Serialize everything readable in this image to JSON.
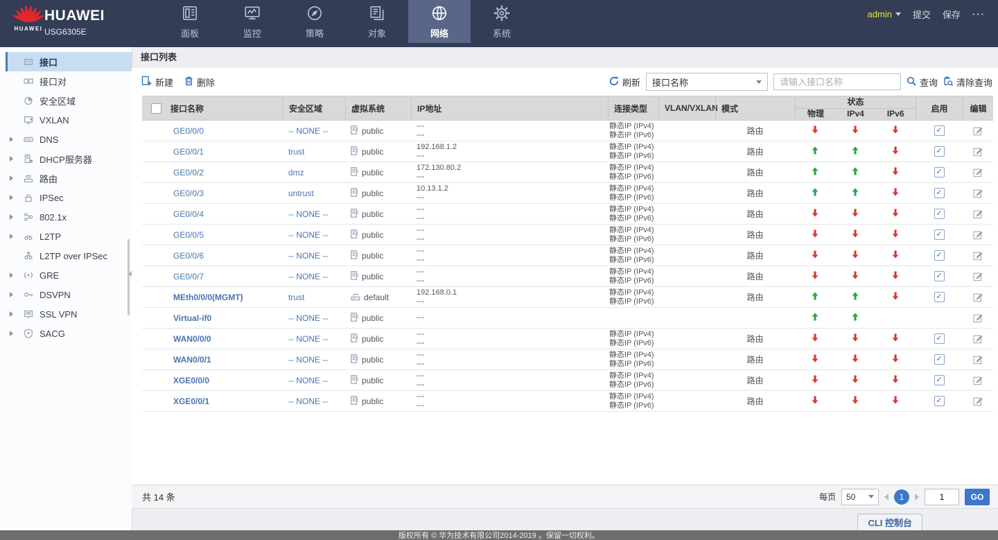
{
  "colors": {
    "nav_bg": "#333d55",
    "nav_active_bg": "#5a6687",
    "accent_blue": "#3a74c0",
    "link_blue": "#4a74ad",
    "status_up": "#2ca44a",
    "status_down": "#d43c35",
    "admin_yellow": "#e9e72e",
    "header_gray": "#d9d9d9"
  },
  "brand": {
    "name": "HUAWEI",
    "model": "USG6305E",
    "logo_caption": "HUAWEI",
    "logo_icon": "huawei-logo"
  },
  "topnav": {
    "items": [
      {
        "id": "dashboard",
        "label": "面板",
        "icon": "dashboard-icon",
        "active": false
      },
      {
        "id": "monitor",
        "label": "监控",
        "icon": "monitor-icon",
        "active": false
      },
      {
        "id": "policy",
        "label": "策略",
        "icon": "policy-icon",
        "active": false
      },
      {
        "id": "object",
        "label": "对象",
        "icon": "object-icon",
        "active": false
      },
      {
        "id": "network",
        "label": "网络",
        "icon": "network-icon",
        "active": true
      },
      {
        "id": "system",
        "label": "系统",
        "icon": "system-icon",
        "active": false
      }
    ],
    "user": "admin",
    "submit_label": "提交",
    "save_label": "保存",
    "more_label": "···"
  },
  "sidebar": {
    "items": [
      {
        "id": "interface",
        "label": "接口",
        "icon": "interface-icon",
        "expandable": false,
        "selected": true
      },
      {
        "id": "interface-pair",
        "label": "接口对",
        "icon": "interface-pair-icon",
        "expandable": false,
        "selected": false
      },
      {
        "id": "security-zone",
        "label": "安全区域",
        "icon": "security-zone-icon",
        "expandable": false,
        "selected": false
      },
      {
        "id": "vxlan",
        "label": "VXLAN",
        "icon": "vxlan-icon",
        "expandable": false,
        "selected": false
      },
      {
        "id": "dns",
        "label": "DNS",
        "icon": "dns-icon",
        "expandable": true,
        "selected": false
      },
      {
        "id": "dhcp",
        "label": "DHCP服务器",
        "icon": "dhcp-icon",
        "expandable": true,
        "selected": false
      },
      {
        "id": "route",
        "label": "路由",
        "icon": "route-icon",
        "expandable": true,
        "selected": false
      },
      {
        "id": "ipsec",
        "label": "IPSec",
        "icon": "ipsec-icon",
        "expandable": true,
        "selected": false
      },
      {
        "id": "8021x",
        "label": "802.1x",
        "icon": "8021x-icon",
        "expandable": true,
        "selected": false
      },
      {
        "id": "l2tp",
        "label": "L2TP",
        "icon": "l2tp-icon",
        "expandable": true,
        "selected": false
      },
      {
        "id": "l2tp-over-ipsec",
        "label": "L2TP over IPSec",
        "icon": "l2tp-ipsec-icon",
        "expandable": false,
        "selected": false
      },
      {
        "id": "gre",
        "label": "GRE",
        "icon": "gre-icon",
        "expandable": true,
        "selected": false
      },
      {
        "id": "dsvpn",
        "label": "DSVPN",
        "icon": "dsvpn-icon",
        "expandable": true,
        "selected": false
      },
      {
        "id": "ssl-vpn",
        "label": "SSL VPN",
        "icon": "ssl-vpn-icon",
        "expandable": true,
        "selected": false
      },
      {
        "id": "sacg",
        "label": "SACG",
        "icon": "sacg-icon",
        "expandable": true,
        "selected": false
      }
    ]
  },
  "panel": {
    "title": "接口列表"
  },
  "toolbar": {
    "new_label": "新建",
    "delete_label": "删除",
    "refresh_label": "刷新",
    "filter_selected": "接口名称",
    "search_placeholder": "请输入接口名称",
    "query_label": "查询",
    "clear_label": "清除查询"
  },
  "table": {
    "headers": {
      "name": "接口名称",
      "zone": "安全区域",
      "vsys": "虚拟系统",
      "ip": "IP地址",
      "conn": "连接类型",
      "vlan": "VLAN/VXLAN",
      "mode": "模式",
      "status": "状态",
      "phys": "物理",
      "ipv4": "IPv4",
      "ipv6": "IPv6",
      "enable": "启用",
      "edit": "编辑"
    },
    "rows": [
      {
        "name": "GE0/0/0",
        "bold": false,
        "zone": "-- NONE --",
        "vsys": "public",
        "vsys_icon": "vsys-public-icon",
        "ip": [
          "---",
          "---"
        ],
        "conn": [
          "静态IP (IPv4)",
          "静态IP (IPv6)"
        ],
        "mode": "路由",
        "phys": "down",
        "ipv4": "down",
        "ipv6": "down",
        "enabled": true
      },
      {
        "name": "GE0/0/1",
        "bold": false,
        "zone": "trust",
        "vsys": "public",
        "vsys_icon": "vsys-public-icon",
        "ip": [
          "192.168.1.2",
          "---"
        ],
        "conn": [
          "静态IP (IPv4)",
          "静态IP (IPv6)"
        ],
        "mode": "路由",
        "phys": "up",
        "ipv4": "up",
        "ipv6": "down",
        "enabled": true
      },
      {
        "name": "GE0/0/2",
        "bold": false,
        "zone": "dmz",
        "vsys": "public",
        "vsys_icon": "vsys-public-icon",
        "ip": [
          "172.130.80.2",
          "---"
        ],
        "conn": [
          "静态IP (IPv4)",
          "静态IP (IPv6)"
        ],
        "mode": "路由",
        "phys": "up",
        "ipv4": "up",
        "ipv6": "down",
        "enabled": true
      },
      {
        "name": "GE0/0/3",
        "bold": false,
        "zone": "untrust",
        "vsys": "public",
        "vsys_icon": "vsys-public-icon",
        "ip": [
          "10.13.1.2",
          "---"
        ],
        "conn": [
          "静态IP (IPv4)",
          "静态IP (IPv6)"
        ],
        "mode": "路由",
        "phys": "up",
        "ipv4": "up",
        "ipv6": "down",
        "enabled": true
      },
      {
        "name": "GE0/0/4",
        "bold": false,
        "zone": "-- NONE --",
        "vsys": "public",
        "vsys_icon": "vsys-public-icon",
        "ip": [
          "---",
          "---"
        ],
        "conn": [
          "静态IP (IPv4)",
          "静态IP (IPv6)"
        ],
        "mode": "路由",
        "phys": "down",
        "ipv4": "down",
        "ipv6": "down",
        "enabled": true
      },
      {
        "name": "GE0/0/5",
        "bold": false,
        "zone": "-- NONE --",
        "vsys": "public",
        "vsys_icon": "vsys-public-icon",
        "ip": [
          "---",
          "---"
        ],
        "conn": [
          "静态IP (IPv4)",
          "静态IP (IPv6)"
        ],
        "mode": "路由",
        "phys": "down",
        "ipv4": "down",
        "ipv6": "down",
        "enabled": true
      },
      {
        "name": "GE0/0/6",
        "bold": false,
        "zone": "-- NONE --",
        "vsys": "public",
        "vsys_icon": "vsys-public-icon",
        "ip": [
          "---",
          "---"
        ],
        "conn": [
          "静态IP (IPv4)",
          "静态IP (IPv6)"
        ],
        "mode": "路由",
        "phys": "down",
        "ipv4": "down",
        "ipv6": "down",
        "enabled": true
      },
      {
        "name": "GE0/0/7",
        "bold": false,
        "zone": "-- NONE --",
        "vsys": "public",
        "vsys_icon": "vsys-public-icon",
        "ip": [
          "---",
          "---"
        ],
        "conn": [
          "静态IP (IPv4)",
          "静态IP (IPv6)"
        ],
        "mode": "路由",
        "phys": "down",
        "ipv4": "down",
        "ipv6": "down",
        "enabled": true
      },
      {
        "name": "MEth0/0/0(MGMT)",
        "bold": true,
        "zone": "trust",
        "vsys": "default",
        "vsys_icon": "vsys-root-icon",
        "ip": [
          "192.168.0.1",
          "---"
        ],
        "conn": [
          "静态IP (IPv4)",
          "静态IP (IPv6)"
        ],
        "mode": "路由",
        "phys": "up",
        "ipv4": "up",
        "ipv6": "down",
        "enabled": true
      },
      {
        "name": "Virtual-if0",
        "bold": true,
        "zone": "-- NONE --",
        "vsys": "public",
        "vsys_icon": "vsys-public-icon",
        "ip": [
          "---"
        ],
        "conn": [],
        "mode": "",
        "phys": "up",
        "ipv4": "up",
        "ipv6": "",
        "enabled": false
      },
      {
        "name": "WAN0/0/0",
        "bold": true,
        "zone": "-- NONE --",
        "vsys": "public",
        "vsys_icon": "vsys-public-icon",
        "ip": [
          "---",
          "---"
        ],
        "conn": [
          "静态IP (IPv4)",
          "静态IP (IPv6)"
        ],
        "mode": "路由",
        "phys": "down",
        "ipv4": "down",
        "ipv6": "down",
        "enabled": true
      },
      {
        "name": "WAN0/0/1",
        "bold": true,
        "zone": "-- NONE --",
        "vsys": "public",
        "vsys_icon": "vsys-public-icon",
        "ip": [
          "---",
          "---"
        ],
        "conn": [
          "静态IP (IPv4)",
          "静态IP (IPv6)"
        ],
        "mode": "路由",
        "phys": "down",
        "ipv4": "down",
        "ipv6": "down",
        "enabled": true
      },
      {
        "name": "XGE0/0/0",
        "bold": true,
        "zone": "-- NONE --",
        "vsys": "public",
        "vsys_icon": "vsys-public-icon",
        "ip": [
          "---",
          "---"
        ],
        "conn": [
          "静态IP (IPv4)",
          "静态IP (IPv6)"
        ],
        "mode": "路由",
        "phys": "down",
        "ipv4": "down",
        "ipv6": "down",
        "enabled": true
      },
      {
        "name": "XGE0/0/1",
        "bold": true,
        "zone": "-- NONE --",
        "vsys": "public",
        "vsys_icon": "vsys-public-icon",
        "ip": [
          "---",
          "---"
        ],
        "conn": [
          "静态IP (IPv4)",
          "静态IP (IPv6)"
        ],
        "mode": "路由",
        "phys": "down",
        "ipv4": "down",
        "ipv6": "down",
        "enabled": true
      }
    ]
  },
  "pagination": {
    "total": "共 14 条",
    "per_page_label": "每页",
    "per_page": "50",
    "current_page": "1",
    "page_input": "1",
    "go_label": "GO"
  },
  "cli_label": "CLI 控制台",
  "footer_text": "版权所有 © 华为技术有限公司2014-2019 。保留一切权利。"
}
